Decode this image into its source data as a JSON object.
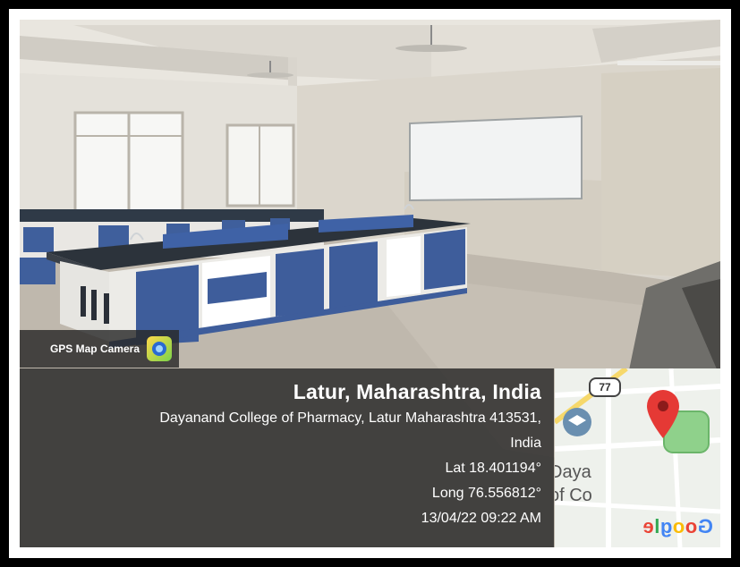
{
  "badge": {
    "label": "GPS Map Camera",
    "icon": "camera-app-icon"
  },
  "location": {
    "title": "Latur, Maharashtra, India",
    "address_line1": "Dayanand College of Pharmacy, Latur Maharashtra 413531,",
    "address_line2": "India",
    "lat": "Lat 18.401194°",
    "long": "Long 76.556812°",
    "datetime": "13/04/22 09:22 AM"
  },
  "map": {
    "logo_text": "Google",
    "route_number": "77",
    "place_fragment_1": "Daya",
    "place_fragment_2": "of Co",
    "pin_color": "#e53935",
    "park_color": "#8fd18b"
  },
  "colors": {
    "overlay": "#232323",
    "frame": "#000000"
  }
}
